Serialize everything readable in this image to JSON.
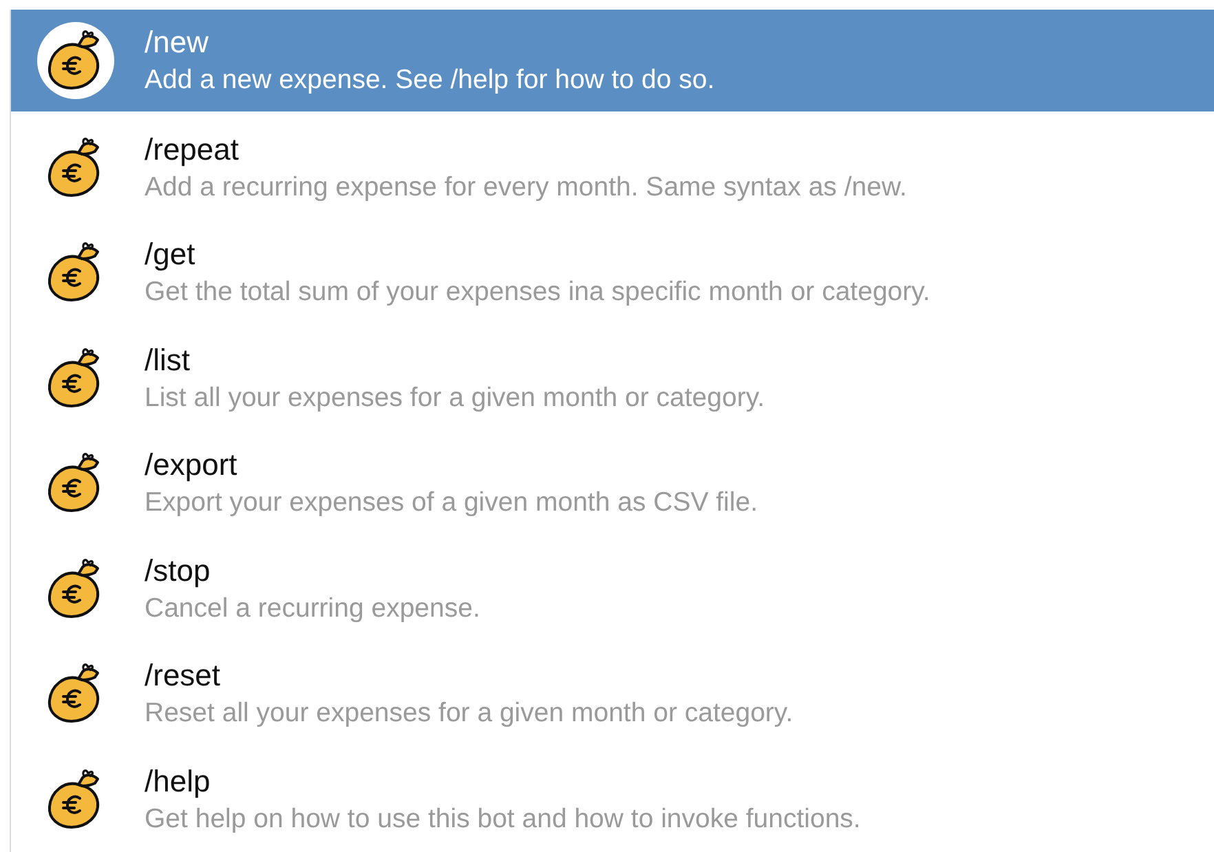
{
  "commands": [
    {
      "command": "/new",
      "description": "Add a new expense. See /help for how to do so.",
      "selected": true
    },
    {
      "command": "/repeat",
      "description": "Add a recurring expense for every month. Same syntax as /new.",
      "selected": false
    },
    {
      "command": "/get",
      "description": "Get the total sum of your expenses ina specific month or category.",
      "selected": false
    },
    {
      "command": "/list",
      "description": "List all your expenses for a given month or category.",
      "selected": false
    },
    {
      "command": "/export",
      "description": "Export your expenses of a given month as CSV file.",
      "selected": false
    },
    {
      "command": "/stop",
      "description": "Cancel a recurring expense.",
      "selected": false
    },
    {
      "command": "/reset",
      "description": "Reset all your expenses for a given month or category.",
      "selected": false
    },
    {
      "command": "/help",
      "description": "Get help on how to use this bot and how to invoke functions.",
      "selected": false
    }
  ]
}
